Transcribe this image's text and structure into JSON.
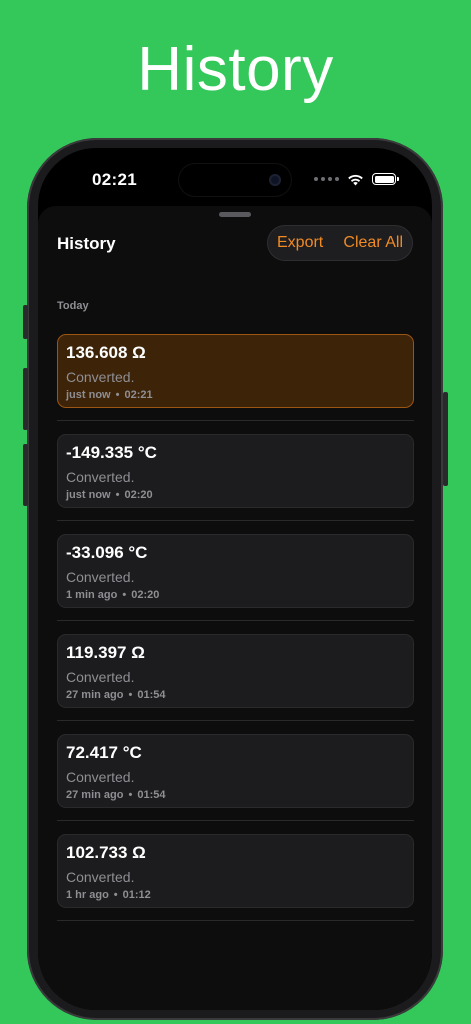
{
  "hero": {
    "title": "History"
  },
  "status_bar": {
    "time": "02:21"
  },
  "sheet": {
    "title": "History",
    "export_label": "Export",
    "clear_all_label": "Clear All",
    "section_label": "Today"
  },
  "accent_color": "#f08a24",
  "background_color": "#34c85a",
  "items": [
    {
      "value": "136.608 Ω",
      "description": "Converted.",
      "relative_time": "just now",
      "time": "02:21",
      "selected": true
    },
    {
      "value": "-149.335 °C",
      "description": "Converted.",
      "relative_time": "just now",
      "time": "02:20",
      "selected": false
    },
    {
      "value": "-33.096 °C",
      "description": "Converted.",
      "relative_time": "1 min ago",
      "time": "02:20",
      "selected": false
    },
    {
      "value": "119.397 Ω",
      "description": "Converted.",
      "relative_time": "27 min ago",
      "time": "01:54",
      "selected": false
    },
    {
      "value": "72.417 °C",
      "description": "Converted.",
      "relative_time": "27 min ago",
      "time": "01:54",
      "selected": false
    },
    {
      "value": "102.733 Ω",
      "description": "Converted.",
      "relative_time": "1 hr ago",
      "time": "01:12",
      "selected": false
    }
  ],
  "meta_separator": "•"
}
